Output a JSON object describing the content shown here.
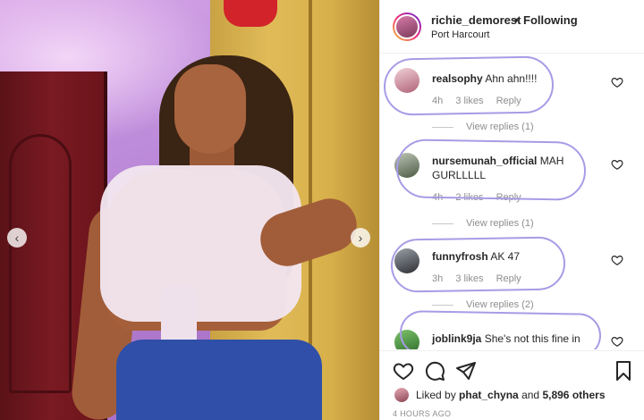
{
  "post": {
    "username": "richie_demorest",
    "separator": "•",
    "follow_status": "Following",
    "location": "Port Harcourt"
  },
  "comments": [
    {
      "username": "realsophy",
      "text": "Ahn ahn!!!!",
      "time": "4h",
      "likes": "3 likes",
      "reply": "Reply",
      "view_replies": "View replies (1)"
    },
    {
      "username": "nursemunah_official",
      "text": "MAH GURLLLLL",
      "time": "4h",
      "likes": "2 likes",
      "reply": "Reply",
      "view_replies": "View replies (1)"
    },
    {
      "username": "funnyfrosh",
      "text": "AK 47",
      "time": "3h",
      "likes": "3 likes",
      "reply": "Reply",
      "view_replies": "View replies (2)"
    },
    {
      "username": "joblink9ja",
      "text": "She's not this fine in"
    }
  ],
  "liked_by": {
    "prefix": "Liked by",
    "user": "phat_chyna",
    "conjunction": "and",
    "others": "5,896 others"
  },
  "timestamp": "4 HOURS AGO",
  "icons": {
    "nav_prev": "chevron-left-icon",
    "nav_next": "chevron-right-icon",
    "like": "heart-icon",
    "comment": "comment-icon",
    "share": "paper-plane-icon",
    "save": "bookmark-icon"
  },
  "colors": {
    "highlight": "#a89be6",
    "text": "#262626",
    "muted": "#8e8e8e"
  }
}
